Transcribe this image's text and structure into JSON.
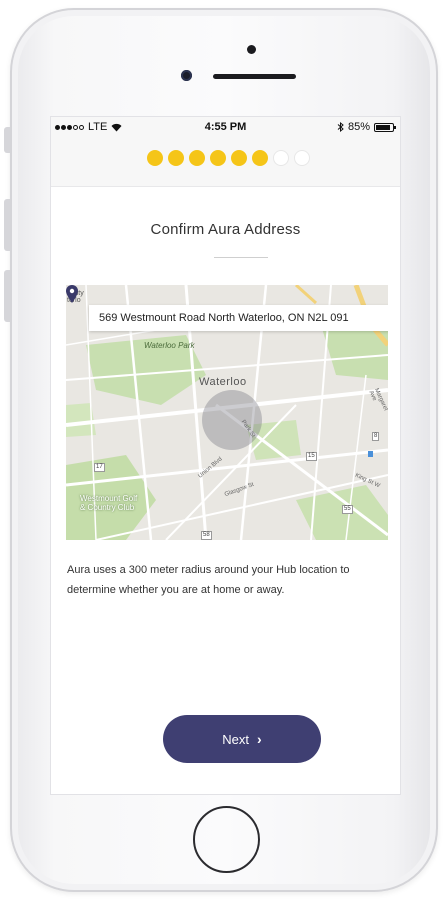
{
  "status_bar": {
    "carrier": "LTE",
    "time": "4:55 PM",
    "bluetooth_icon": "bluetooth-icon",
    "battery_text": "85%",
    "battery_level": 0.85,
    "signal_bars_filled": 3,
    "signal_bars_total": 5
  },
  "progress": {
    "steps_total": 8,
    "steps_done": 6,
    "done_color": "#f5c518"
  },
  "screen": {
    "title": "Confirm Aura Address"
  },
  "map": {
    "address": "569 Westmount Road North Waterloo, ON N2L 091",
    "labels": {
      "city": "Waterloo",
      "park": "Waterloo Park",
      "golf": "Westmount Golf\n& Country Club",
      "edge_top": "ersity\nterlo",
      "street_park": "Park St",
      "street_union": "Union Blvd",
      "street_glasgow": "Glasgow St",
      "street_king": "King St W",
      "street_margaret": "Margaret Ave",
      "shield_17": "17",
      "shield_15": "15",
      "shield_55": "55",
      "shield_58": "58",
      "shield_8": "8"
    }
  },
  "info": {
    "text": "Aura uses a 300 meter radius around your Hub location to determine whether you are at home or away."
  },
  "actions": {
    "next_label": "Next",
    "accent_color": "#3f3f72"
  }
}
